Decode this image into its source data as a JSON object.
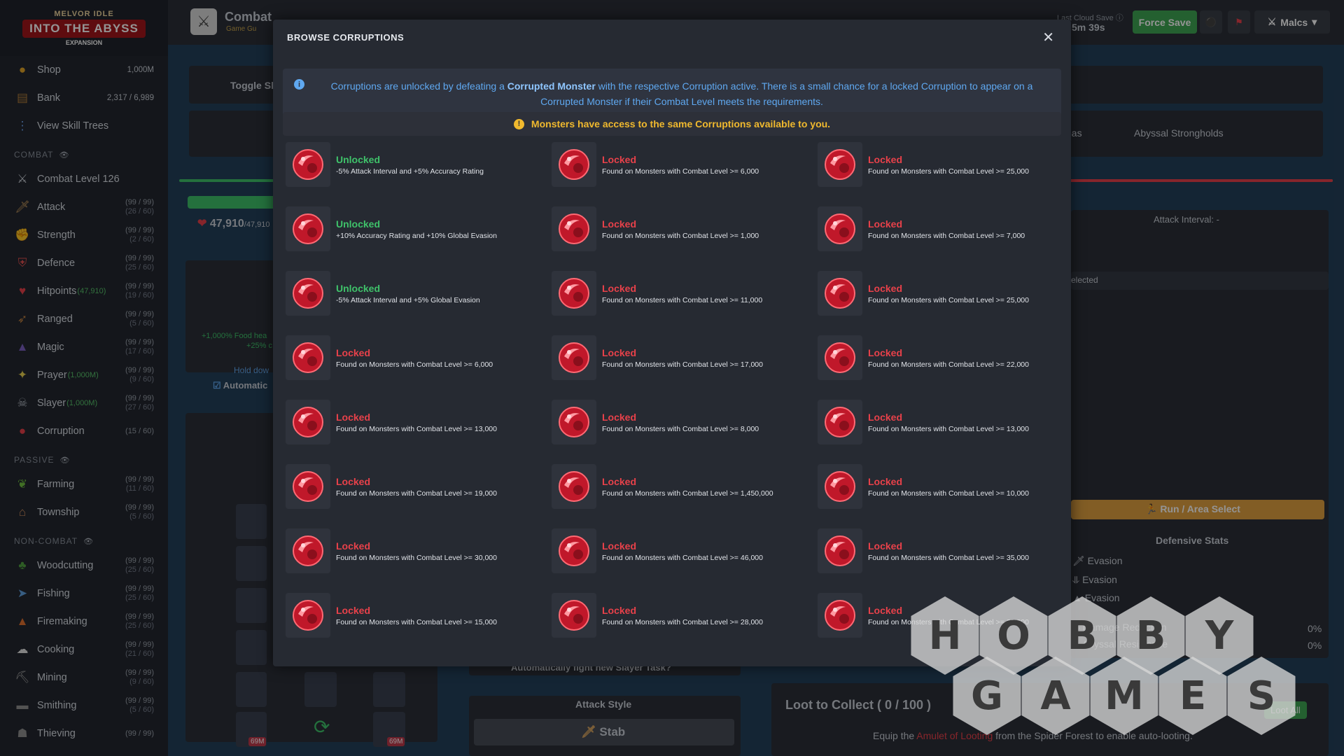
{
  "logo": {
    "line1": "MELVOR IDLE",
    "line2": "INTO THE ABYSS",
    "line3": "EXPANSION"
  },
  "sidebar": {
    "top": [
      {
        "label": "Shop",
        "right": "1,000M",
        "icon": "coin",
        "color": "#e0a428"
      },
      {
        "label": "Bank",
        "right": "2,317 / 6,989",
        "icon": "bank",
        "color": "#b07d3a"
      },
      {
        "label": "View Skill Trees",
        "right": "",
        "icon": "tree",
        "color": "#6aa0e8"
      }
    ],
    "combat_header": "COMBAT",
    "combat": [
      {
        "label": "Combat Level 126",
        "extra": "",
        "lvl": "",
        "lvl2": "",
        "icon": "swords",
        "color": "#c9ced6"
      },
      {
        "label": "Attack",
        "extra": "",
        "lvl": "(99 / 99)",
        "lvl2": "(26 / 60)",
        "icon": "sword",
        "color": "#d0a060"
      },
      {
        "label": "Strength",
        "extra": "",
        "lvl": "(99 / 99)",
        "lvl2": "(2 / 60)",
        "icon": "fist",
        "color": "#e8b070"
      },
      {
        "label": "Defence",
        "extra": "",
        "lvl": "(99 / 99)",
        "lvl2": "(25 / 60)",
        "icon": "shield",
        "color": "#e05050"
      },
      {
        "label": "Hitpoints",
        "extra": "(47,910)",
        "lvl": "(99 / 99)",
        "lvl2": "(19 / 60)",
        "icon": "heart",
        "color": "#e8404a"
      },
      {
        "label": "Ranged",
        "extra": "",
        "lvl": "(99 / 99)",
        "lvl2": "(5 / 60)",
        "icon": "bow",
        "color": "#c08040"
      },
      {
        "label": "Magic",
        "extra": "",
        "lvl": "(99 / 99)",
        "lvl2": "(17 / 60)",
        "icon": "wizard-hat",
        "color": "#7a60c0"
      },
      {
        "label": "Prayer",
        "extra": "(1,000M)",
        "lvl": "(99 / 99)",
        "lvl2": "(9 / 60)",
        "icon": "star",
        "color": "#e8d050"
      },
      {
        "label": "Slayer",
        "extra": "(1,000M)",
        "lvl": "(99 / 99)",
        "lvl2": "(27 / 60)",
        "icon": "slayer",
        "color": "#b0b6c0"
      },
      {
        "label": "Corruption",
        "extra": "",
        "lvl": "(15 / 60)",
        "lvl2": "",
        "icon": "corruption",
        "color": "#e8404a"
      }
    ],
    "passive_header": "PASSIVE",
    "passive": [
      {
        "label": "Farming",
        "lvl": "(99 / 99)",
        "lvl2": "(11 / 60)",
        "icon": "sprout",
        "color": "#70c040"
      },
      {
        "label": "Township",
        "lvl": "(99 / 99)",
        "lvl2": "(5 / 60)",
        "icon": "house",
        "color": "#d09060"
      }
    ],
    "noncombat_header": "NON-COMBAT",
    "noncombat": [
      {
        "label": "Woodcutting",
        "lvl": "(99 / 99)",
        "lvl2": "(25 / 60)",
        "icon": "tree-icon",
        "color": "#50a040"
      },
      {
        "label": "Fishing",
        "lvl": "(99 / 99)",
        "lvl2": "(25 / 60)",
        "icon": "fish",
        "color": "#60a0e0"
      },
      {
        "label": "Firemaking",
        "lvl": "(99 / 99)",
        "lvl2": "(25 / 60)",
        "icon": "fire",
        "color": "#e07030"
      },
      {
        "label": "Cooking",
        "lvl": "(99 / 99)",
        "lvl2": "(21 / 60)",
        "icon": "chef-hat",
        "color": "#e0e0e0"
      },
      {
        "label": "Mining",
        "lvl": "(99 / 99)",
        "lvl2": "(9 / 60)",
        "icon": "pickaxe",
        "color": "#a0a0a0"
      },
      {
        "label": "Smithing",
        "lvl": "(99 / 99)",
        "lvl2": "(5 / 60)",
        "icon": "anvil",
        "color": "#909090"
      },
      {
        "label": "Thieving",
        "lvl": "(99 / 99)",
        "lvl2": "",
        "icon": "thief",
        "color": "#909090"
      }
    ]
  },
  "topbar": {
    "title": "Combat",
    "subtitle": "Game Gu",
    "cloud_label": "Last Cloud Save",
    "cloud_time": "5m 39s",
    "force_save": "Force Save",
    "user": "Malcs"
  },
  "background": {
    "toggle": "Toggle Sl",
    "areas": "eas",
    "strongholds": "Abyssal Strongholds",
    "hp": "47,910",
    "hp_max": "/47,910",
    "attack_interval": "Attack Interval: -",
    "selected": "elected",
    "run_area": "Run / Area Select",
    "defensive": "Defensive Stats",
    "evasion": "Evasion",
    "damage_reduction": "Damage Reduction",
    "abyssal_resistance": "Abyssal Resistance",
    "dr_value": "0%",
    "ar_value": "0%",
    "hold_down": "Hold dow",
    "automatic": "Automatic",
    "food": "+1,000% Food hea",
    "food2": "+25% c",
    "auto_slayer": "Automatically fight new Slayer Task?",
    "attack_style": "Attack Style",
    "stab": "Stab",
    "loot_title": "Loot to Collect ( 0 / 100 )",
    "loot_all": "Loot All",
    "loot_pre": "Equip the ",
    "loot_link": "Amulet of Looting",
    "loot_post": " from the Spider Forest to enable auto-looting.",
    "count_69m": "69M"
  },
  "modal": {
    "title": "BROWSE CORRUPTIONS",
    "info_pre": "Corruptions are unlocked by defeating a ",
    "info_bold": "Corrupted Monster",
    "info_post": " with the respective Corruption active. There is a small chance for a locked Corruption to appear on a Corrupted Monster if their Combat Level meets the requirements.",
    "warning": "Monsters have access to the same Corruptions available to you.",
    "items": [
      {
        "status": "Unlocked",
        "desc": "-5% Attack Interval and +5% Accuracy Rating"
      },
      {
        "status": "Locked",
        "desc": "Found on Monsters with Combat Level >= 6,000"
      },
      {
        "status": "Locked",
        "desc": "Found on Monsters with Combat Level >= 25,000"
      },
      {
        "status": "Unlocked",
        "desc": "+10% Accuracy Rating and +10% Global Evasion"
      },
      {
        "status": "Locked",
        "desc": "Found on Monsters with Combat Level >= 1,000"
      },
      {
        "status": "Locked",
        "desc": "Found on Monsters with Combat Level >= 7,000"
      },
      {
        "status": "Unlocked",
        "desc": "-5% Attack Interval and +5% Global Evasion"
      },
      {
        "status": "Locked",
        "desc": "Found on Monsters with Combat Level >= 11,000"
      },
      {
        "status": "Locked",
        "desc": "Found on Monsters with Combat Level >= 25,000"
      },
      {
        "status": "Locked",
        "desc": "Found on Monsters with Combat Level >= 6,000"
      },
      {
        "status": "Locked",
        "desc": "Found on Monsters with Combat Level >= 17,000"
      },
      {
        "status": "Locked",
        "desc": "Found on Monsters with Combat Level >= 22,000"
      },
      {
        "status": "Locked",
        "desc": "Found on Monsters with Combat Level >= 13,000"
      },
      {
        "status": "Locked",
        "desc": "Found on Monsters with Combat Level >= 8,000"
      },
      {
        "status": "Locked",
        "desc": "Found on Monsters with Combat Level >= 13,000"
      },
      {
        "status": "Locked",
        "desc": "Found on Monsters with Combat Level >= 19,000"
      },
      {
        "status": "Locked",
        "desc": "Found on Monsters with Combat Level >= 1,450,000"
      },
      {
        "status": "Locked",
        "desc": "Found on Monsters with Combat Level >= 10,000"
      },
      {
        "status": "Locked",
        "desc": "Found on Monsters with Combat Level >= 30,000"
      },
      {
        "status": "Locked",
        "desc": "Found on Monsters with Combat Level >= 46,000"
      },
      {
        "status": "Locked",
        "desc": "Found on Monsters with Combat Level >= 35,000"
      },
      {
        "status": "Locked",
        "desc": "Found on Monsters with Combat Level >= 15,000"
      },
      {
        "status": "Locked",
        "desc": "Found on Monsters with Combat Level >= 28,000"
      },
      {
        "status": "Locked",
        "desc": "Found on Monsters with Combat Level >= 28,000"
      }
    ]
  },
  "watermark": {
    "row1": [
      "H",
      "O",
      "B",
      "B",
      "Y"
    ],
    "row2": [
      "G",
      "A",
      "M",
      "E",
      "S"
    ]
  },
  "colors": {
    "unlocked": "#3fc26a",
    "locked": "#e8414a",
    "info": "#5fa8f0",
    "warning": "#f0b92e",
    "force_save": "#3ea553"
  }
}
